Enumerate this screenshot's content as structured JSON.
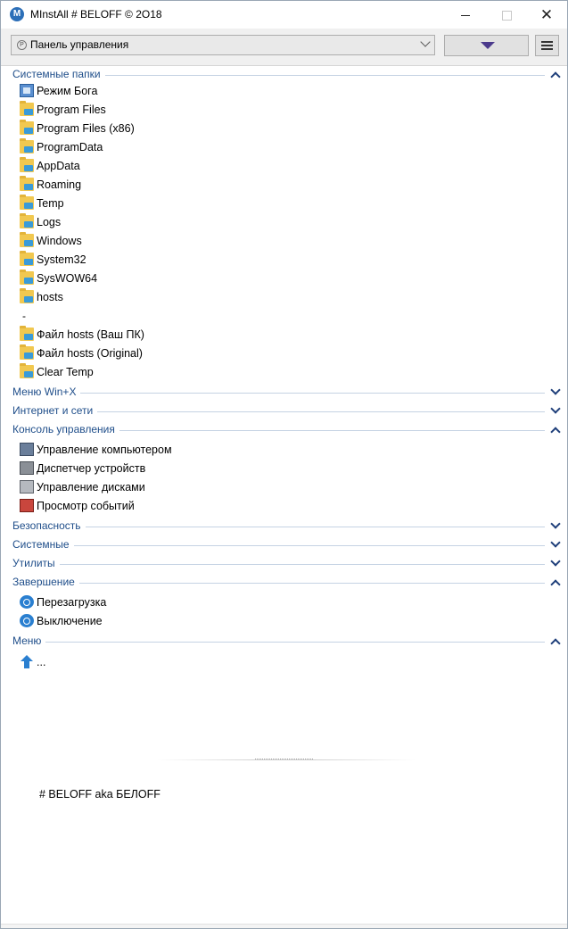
{
  "window": {
    "title": "MInstAll # BELOFF © 2O18",
    "app_icon_glyph": "M",
    "close_glyph": "✕"
  },
  "toolbar": {
    "combo_value": "Панель управления",
    "combo_icon_glyph": "P"
  },
  "sections": {
    "system_folders": {
      "title": "Системные папки",
      "items": [
        {
          "label": "Режим Бога",
          "icon": "god-mode-icon"
        },
        {
          "label": "Program Files",
          "icon": "folder-icon"
        },
        {
          "label": "Program Files (x86)",
          "icon": "folder-icon"
        },
        {
          "label": "ProgramData",
          "icon": "folder-icon"
        },
        {
          "label": "AppData",
          "icon": "folder-icon"
        },
        {
          "label": "Roaming",
          "icon": "folder-icon"
        },
        {
          "label": "Temp",
          "icon": "folder-icon"
        },
        {
          "label": "Logs",
          "icon": "folder-icon"
        },
        {
          "label": "Windows",
          "icon": "folder-icon"
        },
        {
          "label": "System32",
          "icon": "folder-icon"
        },
        {
          "label": "SysWOW64",
          "icon": "folder-icon"
        },
        {
          "label": "hosts",
          "icon": "folder-icon"
        },
        {
          "label": "Файл hosts (Ваш ПК)",
          "icon": "folder-icon"
        },
        {
          "label": "Файл hosts (Original)",
          "icon": "folder-icon"
        },
        {
          "label": "Clear Temp",
          "icon": "folder-icon"
        }
      ],
      "separator": "-"
    },
    "winx": {
      "title": "Меню Win+X"
    },
    "internet": {
      "title": "Интернет и сети"
    },
    "console": {
      "title": "Консоль управления",
      "items": [
        {
          "label": "Управление компьютером",
          "icon": "computer-management-icon"
        },
        {
          "label": "Диспетчер устройств",
          "icon": "device-manager-icon"
        },
        {
          "label": "Управление дисками",
          "icon": "disk-management-icon"
        },
        {
          "label": "Просмотр событий",
          "icon": "event-viewer-icon"
        }
      ]
    },
    "security": {
      "title": "Безопасность"
    },
    "system": {
      "title": "Системные"
    },
    "utilities": {
      "title": "Утилиты"
    },
    "shutdown": {
      "title": "Завершение",
      "items": [
        {
          "label": "Перезагрузка",
          "icon": "restart-icon"
        },
        {
          "label": "Выключение",
          "icon": "power-icon"
        }
      ]
    },
    "menu": {
      "title": "Меню",
      "items": [
        {
          "label": "...",
          "icon": "up-arrow-icon"
        }
      ]
    }
  },
  "footer": {
    "text": "# BELOFF aka БЕЛOFF"
  },
  "colors": {
    "section_title": "#1f4e8a",
    "chevron": "#1f3f7a",
    "dropdown_triangle": "#4b3a8c"
  }
}
